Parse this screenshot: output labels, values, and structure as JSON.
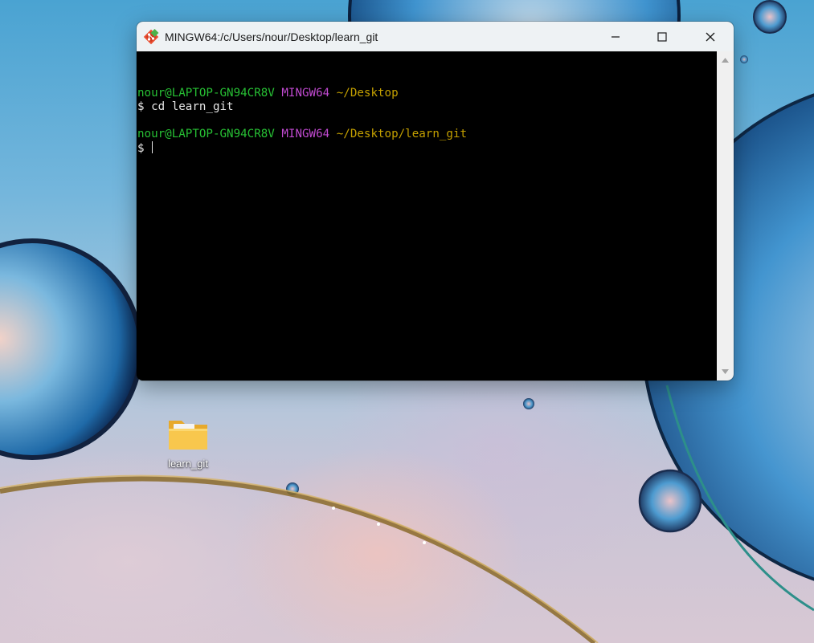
{
  "desktop": {
    "icons": [
      {
        "label": "learn_git",
        "icon": "folder-icon"
      }
    ]
  },
  "window": {
    "title": "MINGW64:/c/Users/nour/Desktop/learn_git",
    "app_icon": "git-icon",
    "controls": {
      "minimize": "minimize-icon",
      "maximize": "maximize-icon",
      "close": "close-icon"
    }
  },
  "terminal": {
    "prompt1": {
      "user_host": "nour@LAPTOP-GN94CR8V",
      "msystem": "MINGW64",
      "path": "~/Desktop"
    },
    "command1": "$ cd learn_git",
    "prompt2": {
      "user_host": "nour@LAPTOP-GN94CR8V",
      "msystem": "MINGW64",
      "path": "~/Desktop/learn_git"
    },
    "input_prompt": "$ ",
    "colors": {
      "background": "#000000",
      "user_host": "#27c034",
      "msystem": "#c04ad0",
      "path": "#c4a000",
      "text": "#e6e6e6"
    }
  }
}
